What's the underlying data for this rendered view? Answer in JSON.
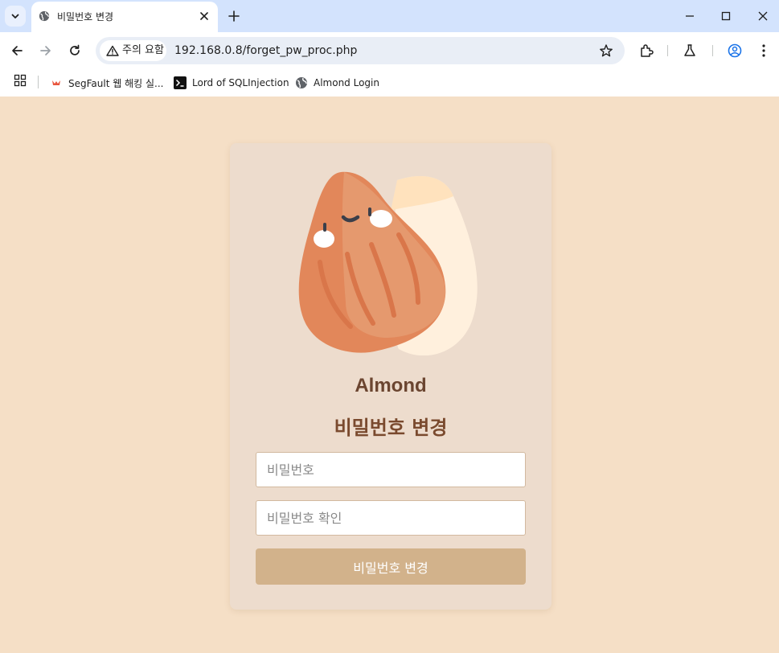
{
  "browser": {
    "tab": {
      "title": "비밀번호 변경"
    },
    "address": {
      "security_chip": "주의 요함",
      "url": "192.168.0.8/forget_pw_proc.php"
    },
    "bookmarks": [
      {
        "label": "SegFault 웹 해킹 실...",
        "icon": "segfault-icon"
      },
      {
        "label": "Lord of SQLInjection",
        "icon": "terminal-icon"
      },
      {
        "label": "Almond Login",
        "icon": "globe-icon"
      }
    ]
  },
  "page": {
    "brand": "Almond",
    "heading": "비밀번호 변경",
    "password": {
      "placeholder": "비밀번호",
      "value": ""
    },
    "password_confirm": {
      "placeholder": "비밀번호 확인",
      "value": ""
    },
    "submit_label": "비밀번호 변경"
  },
  "colors": {
    "page_bg": "#f5dfc6",
    "card_bg": "#eddccd",
    "heading": "#7a4a2e",
    "button": "#d2b28b",
    "tabstrip": "#d3e3fd"
  }
}
